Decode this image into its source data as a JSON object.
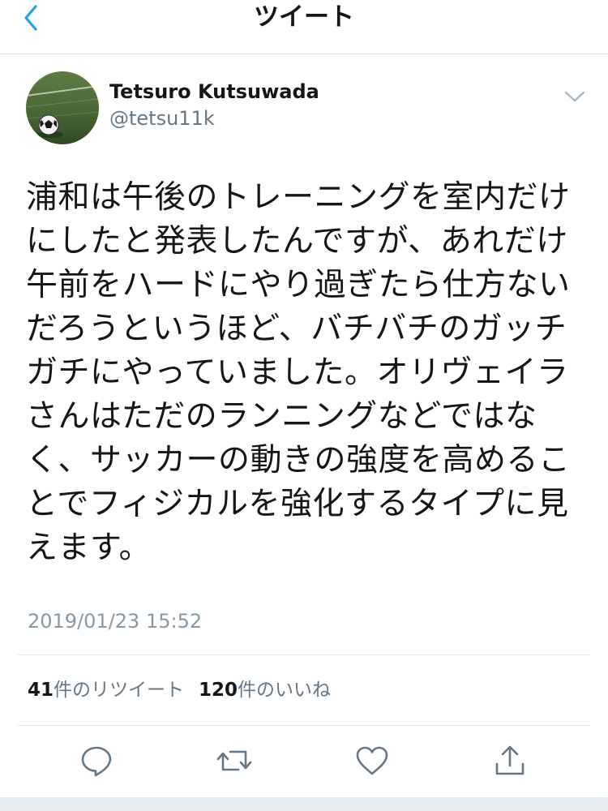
{
  "nav": {
    "title": "ツイート",
    "back_icon": "chevron-left-icon",
    "accent": "#1da1f2"
  },
  "tweet": {
    "display_name": "Tetsuro Kutsuwada",
    "handle": "@tetsu11k",
    "text": "浦和は午後のトレーニングを室内だけ\nにしたと発表したんですが、あれだけ\n午前をハードにやり過ぎたら仕方ない\nだろうというほど、バチバチのガッチ\nガチにやっていました。オリヴェイラ\nさんはただのランニングなどではな\nく、サッカーの動きの強度を高めるこ\nとでフィジカルを強化するタイプに見\nえます。",
    "timestamp": "2019/01/23 15:52"
  },
  "stats": {
    "retweets_count": "41",
    "retweets_label": "件のリツイート",
    "likes_count": "120",
    "likes_label": "件のいいね"
  },
  "actions": [
    {
      "icon": "reply-icon"
    },
    {
      "icon": "retweet-icon"
    },
    {
      "icon": "like-icon"
    },
    {
      "icon": "share-icon"
    }
  ],
  "colors": {
    "text_primary": "#14171a",
    "text_secondary": "#657786",
    "timestamp": "#8899a6",
    "divider": "#e1e8ed",
    "icon": "#657786"
  }
}
